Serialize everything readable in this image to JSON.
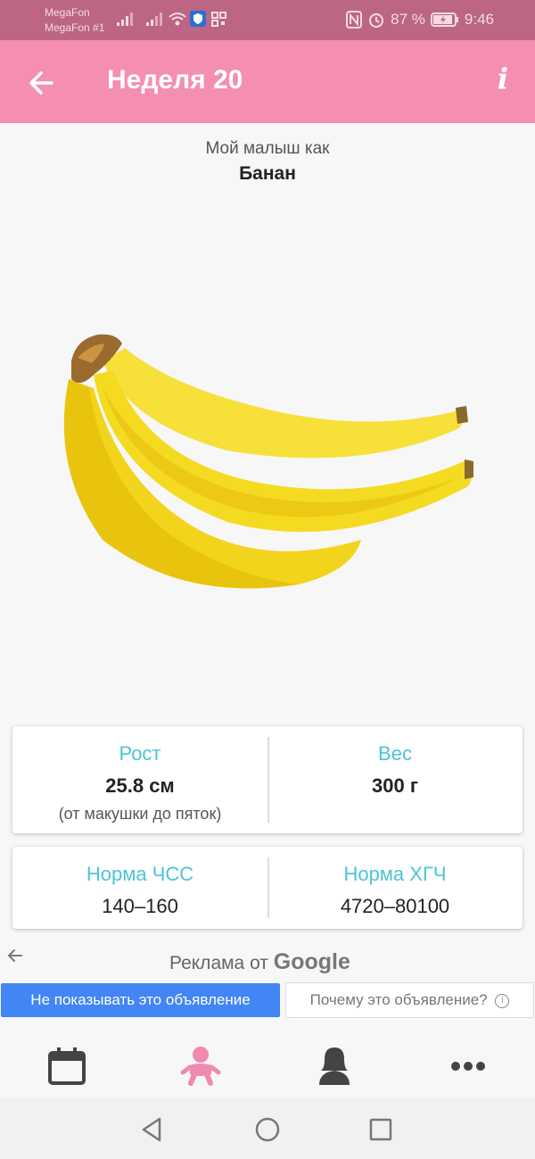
{
  "status_bar": {
    "carrier_1": "MegaFon",
    "carrier_2": "MegaFon #1",
    "battery": "87 %",
    "time": "9:46"
  },
  "app_bar": {
    "title": "Неделя 20",
    "info_label": "i"
  },
  "baby": {
    "caption": "Мой малыш как",
    "fruit": "Банан"
  },
  "stats": {
    "height_label": "Рост",
    "height_value": "25.8 см",
    "height_note": "(от макушки до пяток)",
    "weight_label": "Вес",
    "weight_value": "300 г",
    "hr_label": "Норма ЧСС",
    "hr_value": "140–160",
    "hcg_label": "Норма ХГЧ",
    "hcg_value": "4720–80100"
  },
  "ad": {
    "label": "Реклама от",
    "brand": "Google",
    "hide_button": "Не показывать это объявление",
    "why_button": "Почему это объявление?"
  },
  "bottom_nav": [
    "calendar-icon",
    "baby-icon",
    "mother-icon",
    "more-icon"
  ],
  "colors": {
    "status_bar": "#bd6584",
    "app_bar": "#f48fb1",
    "label": "#4ec3d4",
    "active_tab": "#f08ab0",
    "ad_button": "#4285f4"
  }
}
